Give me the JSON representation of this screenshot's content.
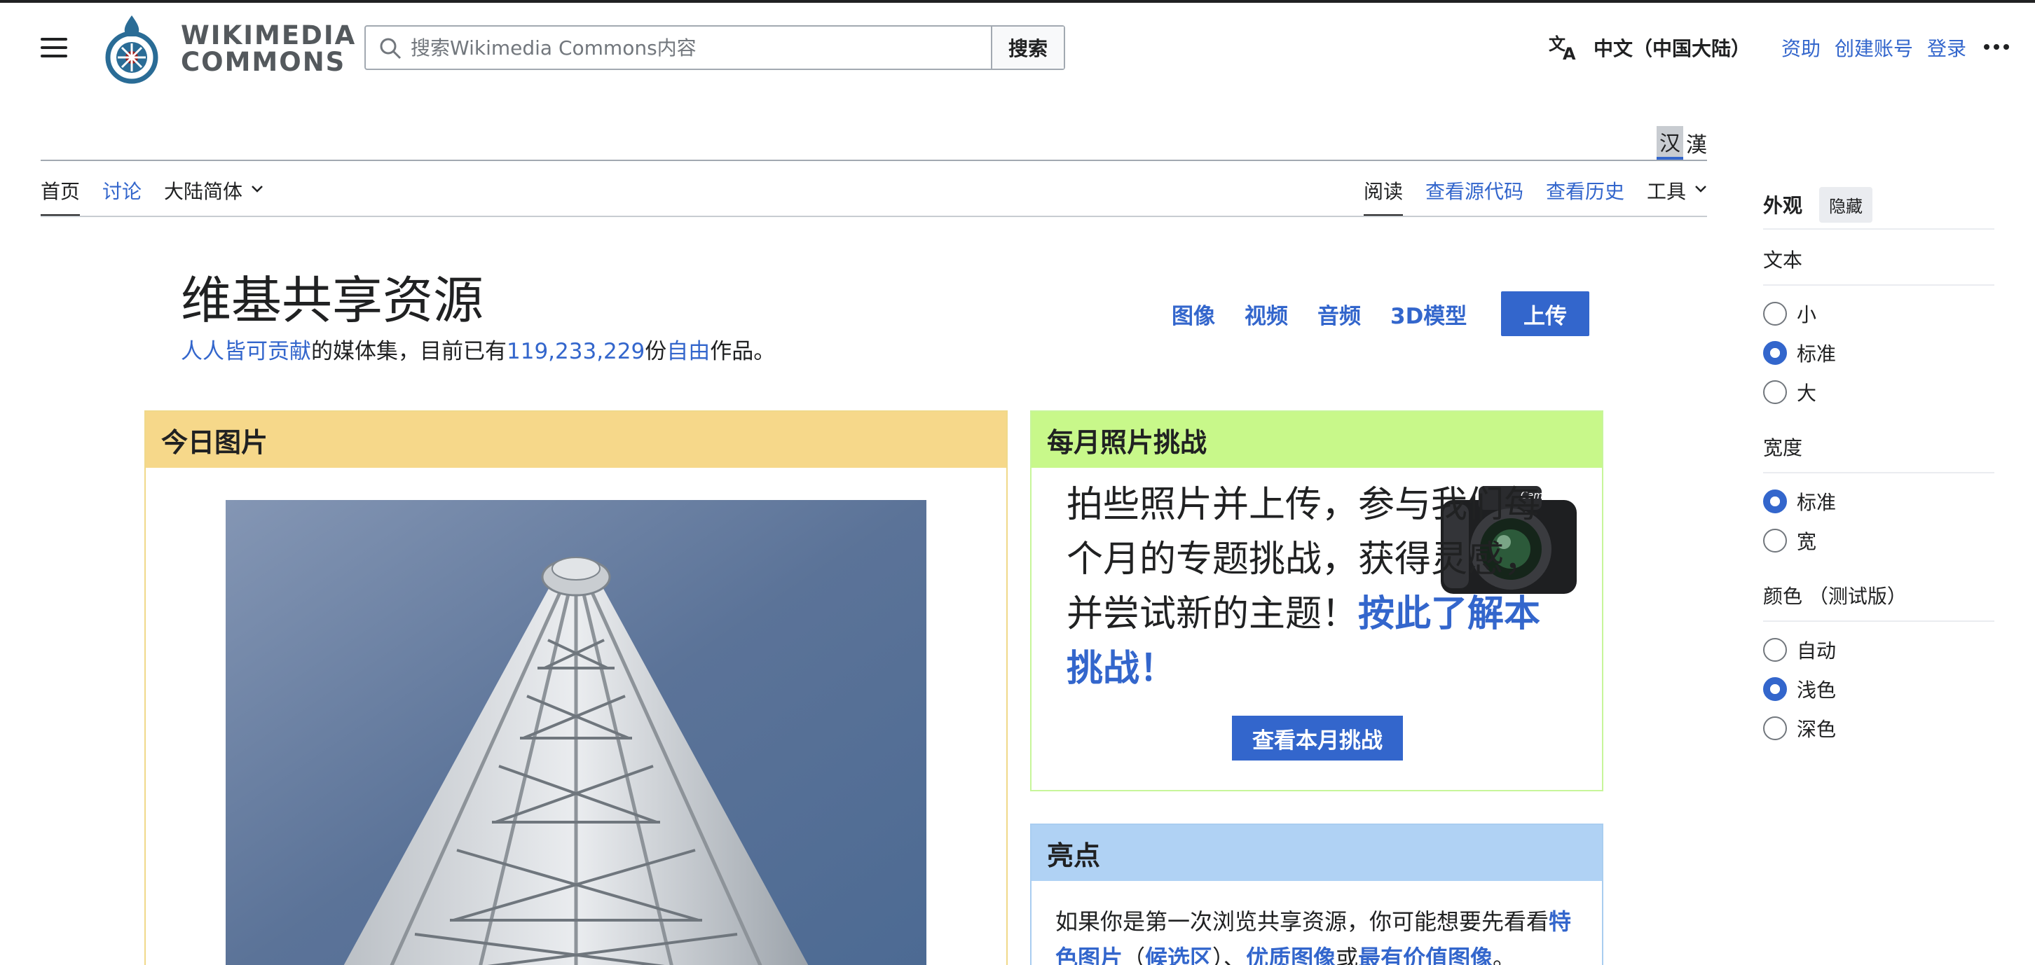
{
  "header": {
    "logo_line1": "WIKIMEDIA",
    "logo_line2": "COMMONS",
    "search_placeholder": "搜索Wikimedia Commons内容",
    "search_button": "搜索",
    "language": "中文（中国大陆）",
    "links": [
      "资助",
      "创建账号",
      "登录"
    ]
  },
  "variant": {
    "simplified": "汉",
    "traditional": "漢"
  },
  "tabs": {
    "left": [
      {
        "label": "首页",
        "state": "selected"
      },
      {
        "label": "讨论",
        "state": "link"
      },
      {
        "label": "大陆简体",
        "state": "dropdown"
      }
    ],
    "right": [
      {
        "label": "阅读",
        "state": "selected"
      },
      {
        "label": "查看源代码",
        "state": "link"
      },
      {
        "label": "查看历史",
        "state": "link"
      },
      {
        "label": "工具",
        "state": "dropdown"
      }
    ]
  },
  "main": {
    "title": "维基共享资源",
    "subtitle_link1": "人人皆可贡献",
    "subtitle_text1": "的媒体集，目前已有",
    "subtitle_count": "119,233,229",
    "subtitle_text2": "份",
    "subtitle_link2": "自由",
    "subtitle_text3": "作品。",
    "media_links": [
      "图像",
      "视频",
      "音频",
      "3D模型"
    ],
    "upload": "上传"
  },
  "potd": {
    "heading": "今日图片"
  },
  "challenge": {
    "heading": "每月照片挑战",
    "body": "拍些照片并上传，参与我们每个月的专题挑战，获得灵感，并尝试新的主题！",
    "link": "按此了解本挑战！",
    "camera_label": "Camera",
    "button": "查看本月挑战"
  },
  "highlights": {
    "heading": "亮点",
    "text1": "如果你是第一次浏览共享资源，你可能想要先看看",
    "link1": "特色图片",
    "text2": "（",
    "link2": "候选区",
    "text3": "）、",
    "link3": "优质图像",
    "text4": "或",
    "link4": "最有价值图像",
    "text5": "。"
  },
  "appearance": {
    "title": "外观",
    "hide": "隐藏",
    "sections": [
      {
        "label": "文本",
        "options": [
          {
            "label": "小",
            "checked": false
          },
          {
            "label": "标准",
            "checked": true
          },
          {
            "label": "大",
            "checked": false
          }
        ]
      },
      {
        "label": "宽度",
        "options": [
          {
            "label": "标准",
            "checked": true
          },
          {
            "label": "宽",
            "checked": false
          }
        ]
      },
      {
        "label": "颜色 （测试版）",
        "options": [
          {
            "label": "自动",
            "checked": false
          },
          {
            "label": "浅色",
            "checked": true
          },
          {
            "label": "深色",
            "checked": false
          }
        ]
      }
    ]
  },
  "colors": {
    "link": "#3366cc",
    "potd_header": "#f6d88a",
    "challenge_header": "#c8f88a",
    "highlights_header": "#b0d2f4"
  }
}
